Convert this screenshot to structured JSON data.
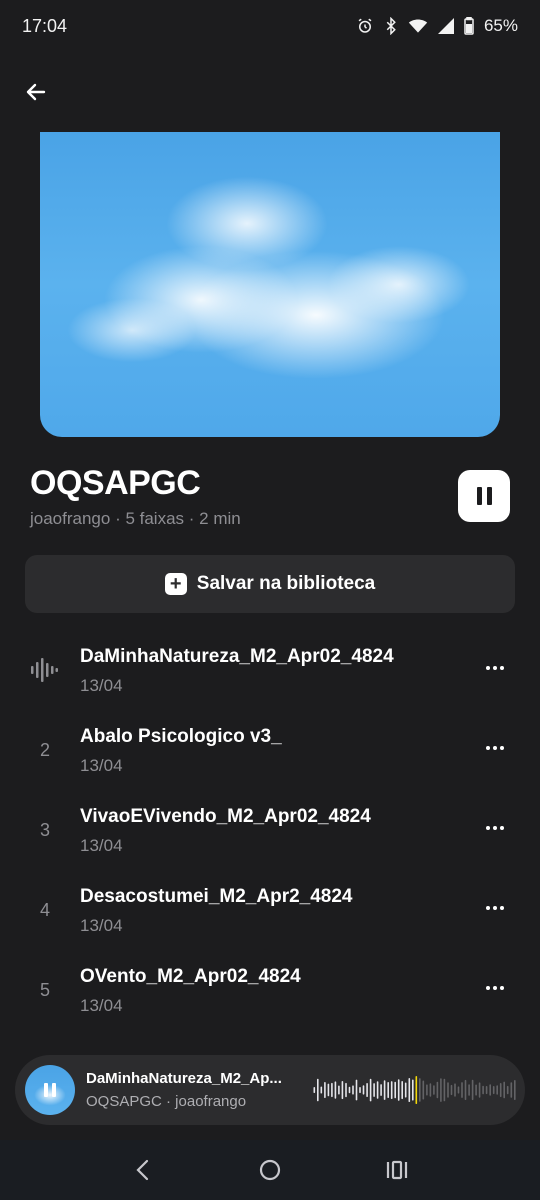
{
  "status_bar": {
    "time": "17:04",
    "battery": "65%",
    "icons": [
      "alarm-icon",
      "bluetooth-icon",
      "wifi-icon",
      "signal-icon",
      "battery-icon"
    ]
  },
  "playlist": {
    "title": "OQSAPGC",
    "meta": "joaofrango · 5 faixas · 2 min",
    "save_label": "Salvar na biblioteca"
  },
  "tracks": [
    {
      "number": "",
      "title": "DaMinhaNatureza_M2_Apr02_4824",
      "date": "13/04",
      "playing": true
    },
    {
      "number": "2",
      "title": "Abalo Psicologico v3_",
      "date": "13/04",
      "playing": false
    },
    {
      "number": "3",
      "title": "VivaoEVivendo_M2_Apr02_4824",
      "date": "13/04",
      "playing": false
    },
    {
      "number": "4",
      "title": "Desacostumei_M2_Apr2_4824",
      "date": "13/04",
      "playing": false
    },
    {
      "number": "5",
      "title": "OVento_M2_Apr02_4824",
      "date": "13/04",
      "playing": false
    }
  ],
  "mini_player": {
    "title": "DaMinhaNatureza_M2_Ap...",
    "subtitle": "OQSAPGC · joaofrango",
    "progress": 0.5,
    "accent": "#f5d90a"
  },
  "colors": {
    "background": "#1c1c1e",
    "surface": "#2c2c2e",
    "secondary_text": "#8e8e93"
  }
}
